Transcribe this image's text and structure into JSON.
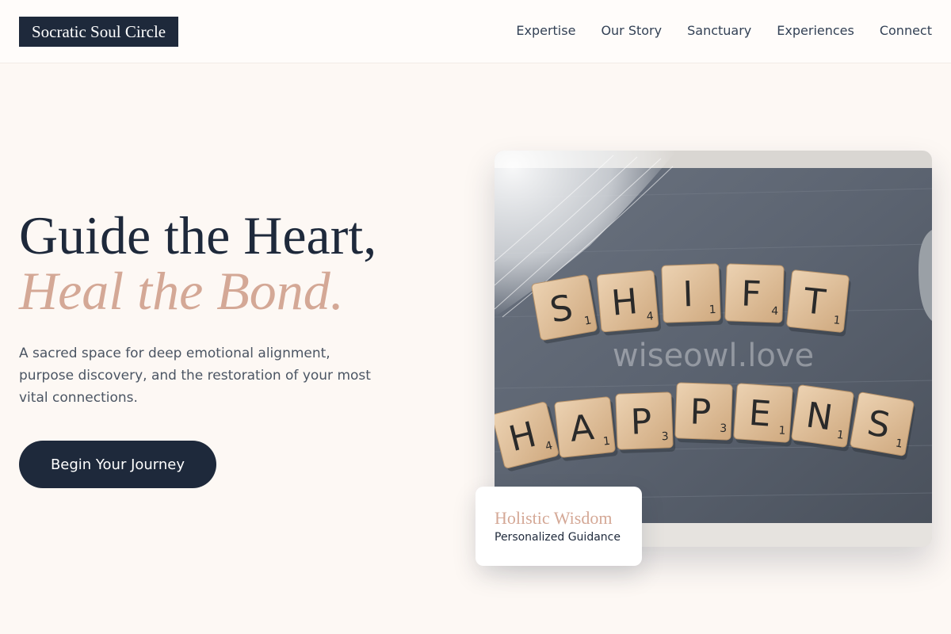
{
  "header": {
    "logo": "Socratic Soul Circle",
    "nav": [
      "Expertise",
      "Our Story",
      "Sanctuary",
      "Experiences",
      "Connect"
    ]
  },
  "hero": {
    "headline_line1": "Guide the Heart,",
    "headline_line2": "Heal the Bond.",
    "subtitle": "A sacred space for deep emotional alignment, purpose discovery, and the restoration of your most vital connections.",
    "cta": "Begin Your Journey"
  },
  "image": {
    "tiles_row1": [
      {
        "letter": "S",
        "value": "1"
      },
      {
        "letter": "H",
        "value": "4"
      },
      {
        "letter": "I",
        "value": "1"
      },
      {
        "letter": "F",
        "value": "4"
      },
      {
        "letter": "T",
        "value": "1"
      }
    ],
    "tiles_row2": [
      {
        "letter": "H",
        "value": "4"
      },
      {
        "letter": "A",
        "value": "1"
      },
      {
        "letter": "P",
        "value": "3"
      },
      {
        "letter": "P",
        "value": "3"
      },
      {
        "letter": "E",
        "value": "1"
      },
      {
        "letter": "N",
        "value": "1"
      },
      {
        "letter": "S",
        "value": "1"
      }
    ],
    "watermark": "wiseowl.love"
  },
  "card": {
    "title": "Holistic Wisdom",
    "subtitle": "Personalized Guidance"
  },
  "colors": {
    "navy": "#1e293b",
    "accent": "#d4a896",
    "background": "#fdf8f4"
  }
}
